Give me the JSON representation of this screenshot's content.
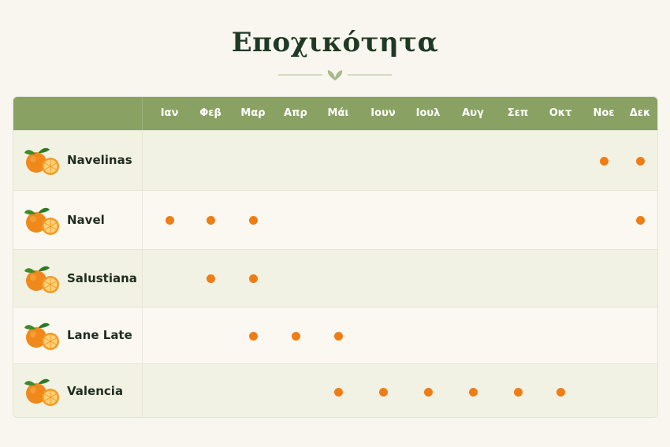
{
  "title": "Εποχικότητα",
  "icon": "leaf-ornament",
  "colors": {
    "header": "#8aa164",
    "dot": "#ef7d16",
    "title": "#1f3a24"
  },
  "months": [
    "Ιαν",
    "Φεβ",
    "Μαρ",
    "Απρ",
    "Μάι",
    "Ιουν",
    "Ιουλ",
    "Αυγ",
    "Σεπ",
    "Οκτ",
    "Νοε",
    "Δεκ"
  ],
  "varieties": [
    {
      "name": "Navelinas",
      "icon": "orange-fruit-icon",
      "months": [
        11,
        12
      ]
    },
    {
      "name": "Navel",
      "icon": "orange-fruit-icon",
      "months": [
        1,
        2,
        3,
        12
      ]
    },
    {
      "name": "Salustiana",
      "icon": "orange-fruit-icon",
      "months": [
        2,
        3
      ]
    },
    {
      "name": "Lane Late",
      "icon": "orange-fruit-icon",
      "months": [
        3,
        4,
        5
      ]
    },
    {
      "name": "Valencia",
      "icon": "orange-fruit-icon",
      "months": [
        5,
        6,
        7,
        8,
        9,
        10
      ]
    }
  ]
}
